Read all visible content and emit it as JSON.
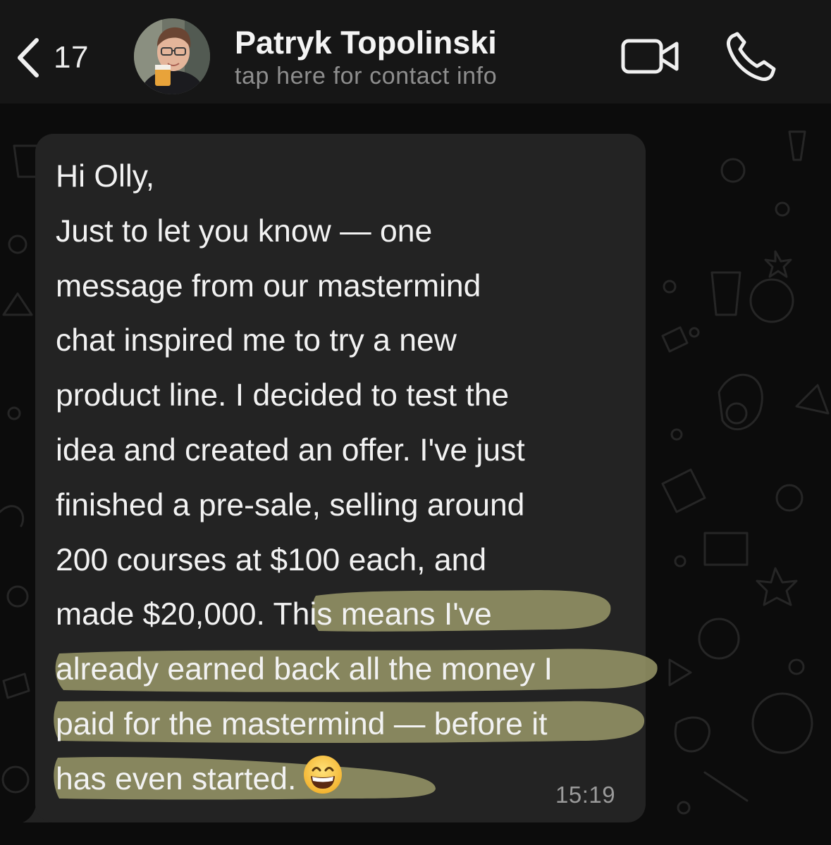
{
  "header": {
    "back_icon": "chevron-left-icon",
    "unread_count": "17",
    "contact_name": "Patryk Topolinski",
    "contact_subtitle": "tap here for contact info",
    "avatar": "contact-photo",
    "video_icon": "video-camera-icon",
    "call_icon": "phone-icon"
  },
  "message": {
    "greeting": "Hi Olly,",
    "body_plain": "Just to let you know — one\nmessage from our mastermind\nchat inspired me to try a new\nproduct line. I decided to test the\nidea and created an offer. I've just\nfinished a pre-sale, selling around\n200 courses at $100 each, and\nmade $20,000. ",
    "body_highlighted": "This means I've\nalready earned back all the money I\npaid for the mastermind — before it\nhas even started.",
    "emoji": "grinning-face-emoji",
    "time": "15:19",
    "highlight_color": "#9e9c6b"
  },
  "theme": {
    "background": "#0c0c0c",
    "header_bg": "#161616",
    "bubble_bg": "#232323",
    "text": "#f2f2f2",
    "secondary_text": "#8e8e8e"
  }
}
